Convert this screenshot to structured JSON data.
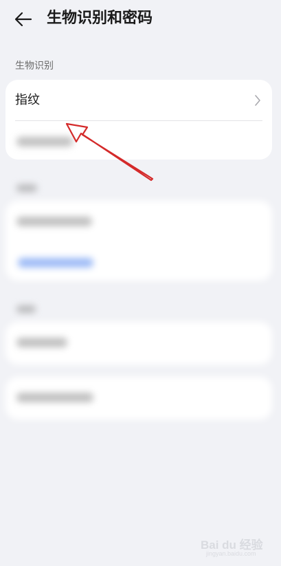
{
  "header": {
    "title": "生物识别和密码",
    "back_icon": "arrow-left-icon"
  },
  "biometrics": {
    "section_label": "生物识别",
    "items": [
      {
        "label": "指纹",
        "icon": "chevron-right-icon"
      }
    ]
  },
  "annotation": {
    "arrow_color": "#d42a2a"
  },
  "watermark": {
    "logo_text": "Bai du 经验",
    "sub_text": "jingyan.baidu.com"
  },
  "colors": {
    "background": "#f1f2f6",
    "card": "#ffffff",
    "accent_blue": "#5b8ef0"
  }
}
